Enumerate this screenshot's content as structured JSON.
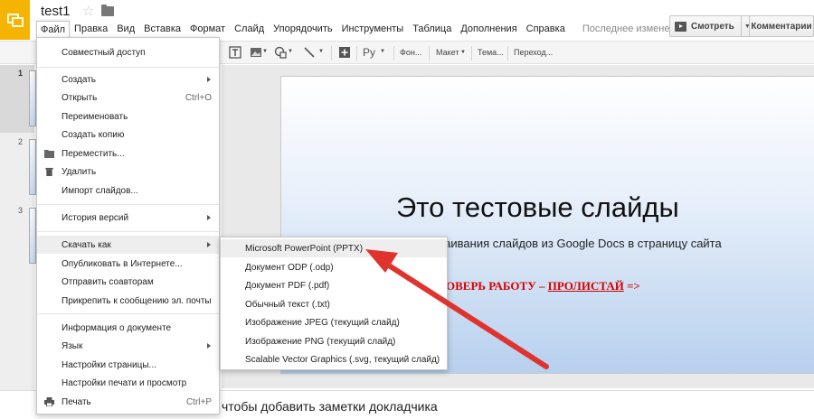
{
  "header": {
    "doc_title": "test1",
    "last_change": "Последнее изменение...",
    "present_label": "Смотреть",
    "comments_label": "Комментарии"
  },
  "menubar": [
    {
      "label": "Файл",
      "active": true
    },
    {
      "label": "Правка"
    },
    {
      "label": "Вид"
    },
    {
      "label": "Вставка"
    },
    {
      "label": "Формат"
    },
    {
      "label": "Слайд"
    },
    {
      "label": "Упорядочить"
    },
    {
      "label": "Инструменты"
    },
    {
      "label": "Таблица"
    },
    {
      "label": "Дополнения"
    },
    {
      "label": "Справка"
    }
  ],
  "toolbar": {
    "font_button": "Ру",
    "background_button": "Фон...",
    "layout_button": "Макет",
    "theme_button": "Тема...",
    "transition_button": "Переход..."
  },
  "filmstrip": {
    "slide_numbers": [
      "1",
      "2",
      "3"
    ]
  },
  "file_menu": {
    "share": "Совместный доступ",
    "new": "Создать",
    "open": "Открыть",
    "open_shortcut": "Ctrl+O",
    "rename": "Переименовать",
    "make_copy": "Создать копию",
    "move": "Переместить...",
    "delete": "Удалить",
    "import_slides": "Импорт слайдов...",
    "version_history": "История версий",
    "download_as": "Скачать как",
    "publish": "Опубликовать в Интернете...",
    "email_collaborators": "Отправить соавторам",
    "email_attachment": "Прикрепить к сообщению эл. почты",
    "document_info": "Информация о документе",
    "language": "Язык",
    "page_setup": "Настройки страницы...",
    "print_settings": "Настройки печати и просмотр",
    "print": "Печать",
    "print_shortcut": "Ctrl+P"
  },
  "download_submenu": [
    "Microsoft PowerPoint (PPTX)",
    "Документ ODP (.odp)",
    "Документ PDF (.pdf)",
    "Обычный текст (.txt)",
    "Изображение JPEG (текущий слайд)",
    "Изображение PNG (текущий слайд)",
    "Scalable Vector Graphics (.svg, текущий слайд)"
  ],
  "slide": {
    "title": "Это тестовые слайды",
    "subtitle": "траивания слайдов из Google Docs в страницу сайта",
    "cta_part1": "ОВЕРЬ РАБОТУ – ",
    "cta_part2": "ПРОЛИСТАЙ",
    "cta_part3": " =>"
  },
  "notes": {
    "placeholder": "чтобы добавить заметки докладчика"
  },
  "colors": {
    "logo": "#f4b400",
    "arrow": "#e0332e",
    "cta": "#d60000"
  }
}
